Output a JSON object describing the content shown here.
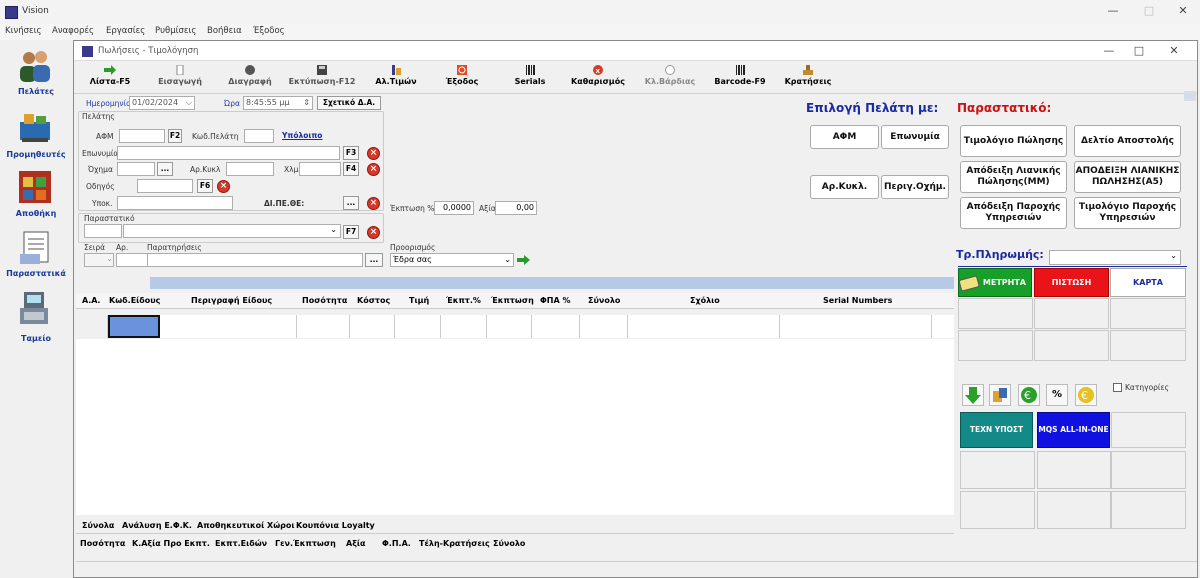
{
  "app": {
    "title": "Vision"
  },
  "menu": [
    "Κινήσεις",
    "Αναφορές",
    "Εργασίες",
    "Ρυθμίσεις",
    "Βοήθεια",
    "Έξοδος"
  ],
  "nav": [
    "Πελάτες",
    "Προμηθευτές",
    "Αποθήκη",
    "Παραστατικά",
    "Ταμείο"
  ],
  "window": {
    "title": "Πωλήσεις - Τιμολόγηση"
  },
  "toolbar": [
    "Λίστα-F5",
    "Εισαγωγή",
    "Διαγραφή",
    "Εκτύπωση-F12",
    "Αλ.Τιμών",
    "Έξοδος",
    "Serials",
    "Καθαρισμός",
    "Κλ.Βάρδιας",
    "Barcode-F9",
    "Κρατήσεις"
  ],
  "form": {
    "date_label": "Ημερομηνία",
    "date": "01/02/2024",
    "time_label": "Ώρα",
    "time": "8:45:55 μμ",
    "related_btn": "Σχετικό Δ.Α.",
    "customer_group": "Πελάτης",
    "afm": "ΑΦΜ",
    "f2": "F2",
    "cust_code": "Κωδ.Πελάτη",
    "balance": "Υπόλοιπο",
    "name": "Επωνυμία",
    "f3": "F3",
    "vehicle": "Όχημα",
    "dots": "...",
    "plate": "Αρ.Κυκλ",
    "km": "Χλμ",
    "f4": "F4",
    "driver": "Οδηγός",
    "f6": "F6",
    "branch": "Υποκ.",
    "dipethe": "ΔΙ.ΠΕ.ΘΕ:",
    "doc_group": "Παραστατικό",
    "f7": "F7",
    "series": "Σειρά",
    "number": "Αρ.",
    "notes": "Παρατηρήσεις",
    "discount_label": "Έκπτωση %",
    "discount": "0,0000",
    "value_label": "Αξία",
    "value": "0,00",
    "dest_label": "Προορισμός",
    "dest": "Έδρα σας"
  },
  "customer_select": {
    "title": "Επιλογή Πελάτη με:",
    "buttons": [
      "ΑΦΜ",
      "Επωνυμία",
      "Αρ.Κυκλ.",
      "Περιγ.Οχήμ."
    ]
  },
  "doc_select": {
    "title": "Παραστατικό:",
    "buttons": [
      "Τιμολόγιο Πώλησης",
      "Δελτίο Αποστολής",
      "Απόδειξη Λιανικής Πώλησης(ΜΜ)",
      "ΑΠΟΔΕΙΞΗ ΛΙΑΝΙΚΗΣ ΠΩΛΗΣΗΣ(Α5)",
      "Απόδειξη Παροχής Υπηρεσιών",
      "Τιμολόγιο Παροχής Υπηρεσιών"
    ]
  },
  "payment": {
    "title": "Τρ.Πληρωμής:",
    "options": [
      "ΜΕΤΡΗΤΑ",
      "ΠΙΣΤΩΣΗ",
      "ΚΑΡΤΑ"
    ]
  },
  "categories": {
    "label": "Κατηγορίες",
    "percent": "%",
    "tiles": [
      "ΤΕΧΝ ΥΠΟΣΤ",
      "MQS ALL-IN-ONE"
    ]
  },
  "grid": {
    "columns": [
      "Α.Α.",
      "Κωδ.Είδους",
      "Περιγραφή Είδους",
      "Ποσότητα",
      "Κόστος",
      "Τιμή",
      "Έκπτ.%",
      "Έκπτωση",
      "ΦΠΑ %",
      "Σύνολο",
      "Σχόλιο",
      "Serial Numbers"
    ]
  },
  "footer_tabs": [
    "Σύνολα",
    "Ανάλυση Ε.Φ.Κ.",
    "Αποθηκευτικοί Χώροι",
    "Κουπόνια Loyalty"
  ],
  "footer_totals": [
    "Ποσότητα",
    "Κ.Αξία Προ Εκπτ.",
    "Εκπτ.Ειδών",
    "Γεν.Έκπτωση",
    "Αξία",
    "Φ.Π.Α.",
    "Τέλη-Κρατήσεις",
    "Σύνολο"
  ],
  "colors": {
    "blue_title": "#1a2aa0",
    "red_title": "#cc1111",
    "cash": "#16a02a",
    "credit": "#e8141a",
    "tech": "#138a88",
    "mqs": "#1010e0",
    "select_cell": "#6a92dd"
  }
}
